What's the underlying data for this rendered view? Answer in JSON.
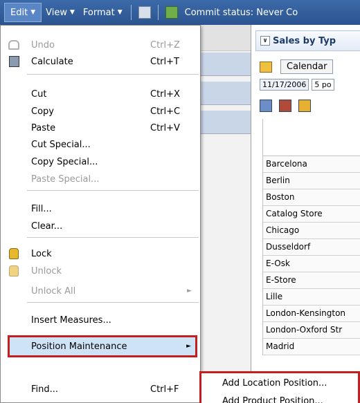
{
  "toolbar": {
    "edit": "Edit",
    "view": "View",
    "format": "Format",
    "commit_status": "Commit status: Never Co"
  },
  "right_panel": {
    "title": "Sales by Typ",
    "calendar_button": "Calendar",
    "date_value": "11/17/2006",
    "period_value": "5 po",
    "stores": [
      "Barcelona",
      "Berlin",
      "Boston",
      "Catalog Store",
      "Chicago",
      "Dusseldorf",
      "E-Osk",
      "E-Store",
      "Lille",
      "London-Kensington",
      "London-Oxford Str",
      "Madrid"
    ]
  },
  "menu": {
    "undo": {
      "label": "Undo",
      "shortcut": "Ctrl+Z"
    },
    "calculate": {
      "label": "Calculate",
      "shortcut": "Ctrl+T"
    },
    "cut": {
      "label": "Cut",
      "shortcut": "Ctrl+X"
    },
    "copy": {
      "label": "Copy",
      "shortcut": "Ctrl+C"
    },
    "paste": {
      "label": "Paste",
      "shortcut": "Ctrl+V"
    },
    "cut_special": {
      "label": "Cut Special..."
    },
    "copy_special": {
      "label": "Copy Special..."
    },
    "paste_special": {
      "label": "Paste Special..."
    },
    "fill": {
      "label": "Fill..."
    },
    "clear": {
      "label": "Clear..."
    },
    "lock": {
      "label": "Lock"
    },
    "unlock": {
      "label": "Unlock"
    },
    "unlock_all": {
      "label": "Unlock All"
    },
    "insert_measures": {
      "label": "Insert Measures..."
    },
    "position_maintenance": {
      "label": "Position Maintenance"
    },
    "find": {
      "label": "Find...",
      "shortcut": "Ctrl+F"
    }
  },
  "submenu": {
    "add_location": "Add Location Position...",
    "add_product": "Add Product Position..."
  },
  "colors": {
    "toolbar_bg": "#2b5490",
    "highlight_border": "#c41e1e",
    "highlight_fill": "#cfe3f7"
  }
}
